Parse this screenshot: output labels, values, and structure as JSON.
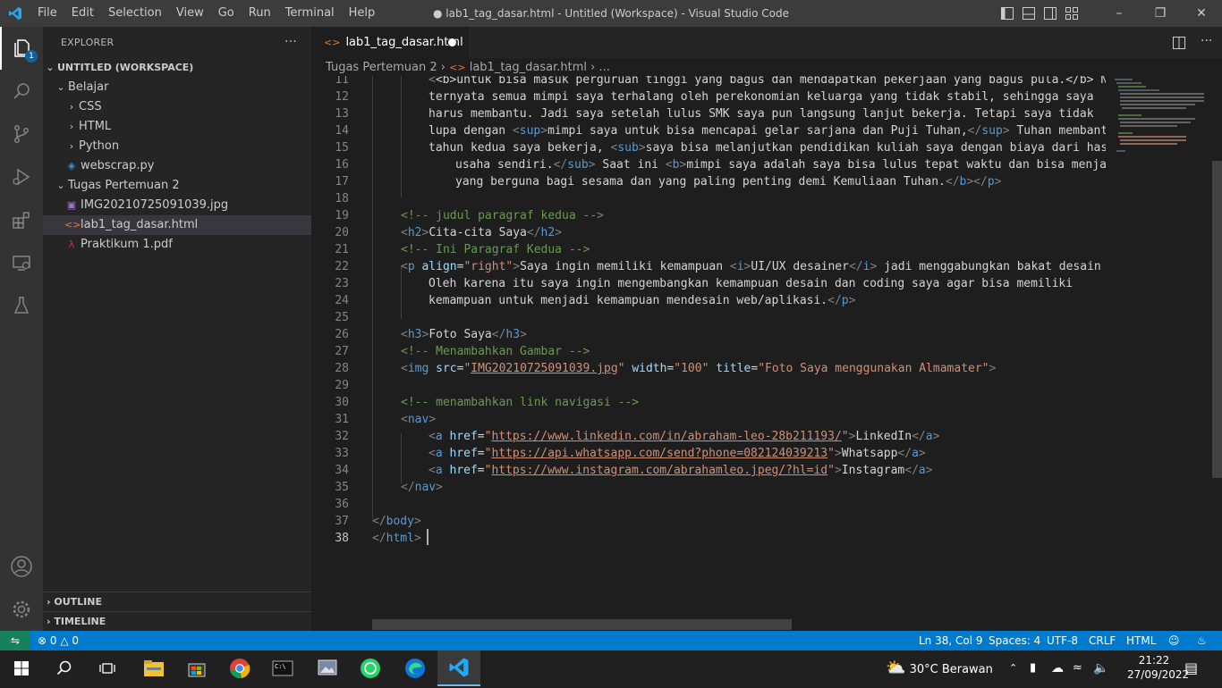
{
  "titlebar": {
    "menu": [
      "File",
      "Edit",
      "Selection",
      "View",
      "Go",
      "Run",
      "Terminal",
      "Help"
    ],
    "title": "● lab1_tag_dasar.html - Untitled (Workspace) - Visual Studio Code"
  },
  "activity": {
    "explorer_badge": "1"
  },
  "sidebar": {
    "header": "EXPLORER",
    "more": "···",
    "workspace": "UNTITLED (WORKSPACE)",
    "folder_belajar": "Belajar",
    "sub_css": "CSS",
    "sub_html": "HTML",
    "sub_python": "Python",
    "file_webscrap": "webscrap.py",
    "folder_tugas": "Tugas Pertemuan 2",
    "file_img": "IMG20210725091039.jpg",
    "file_html": "lab1_tag_dasar.html",
    "file_pdf": "Praktikum 1.pdf",
    "outline": "OUTLINE",
    "timeline": "TIMELINE"
  },
  "tab": {
    "label": "lab1_tag_dasar.html"
  },
  "breadcrumb": {
    "folder": "Tugas Pertemuan 2",
    "file": "lab1_tag_dasar.html",
    "more": "..."
  },
  "code": {
    "l11": "<b>untuk bisa masuk perguruan tinggi yang bagus dan mendapatkan pekerjaan yang bagus pula.</b> Nam",
    "l12": "ternyata semua mimpi saya terhalang oleh perekonomian keluarga yang tidak stabil, sehingga saya",
    "l13": "harus membantu. Jadi saya setelah lulus SMK saya pun langsung lanjut bekerja. Tetapi saya tidak",
    "l14a": "lupa dengan ",
    "l14b": "mimpi saya untuk bisa mencapai gelar sarjana dan Puji Tuhan,",
    "l14c": " Tuhan membantu",
    "l15a": "tahun kedua saya bekerja, ",
    "l15b": "saya bisa melanjutkan pendidikan kuliah saya dengan biaya dari hasil",
    "l16a": "usaha sendiri.",
    "l16b": " Saat ini ",
    "l16c": "mimpi saya adalah saya bisa lulus tepat waktu dan bisa menjadi",
    "l17a": "yang berguna bagi sesama dan yang paling penting demi Kemuliaan Tuhan.",
    "l19": "<!-- judul paragraf kedua -->",
    "l20": "Cita-cita Saya",
    "l21": "<!-- Ini Paragraf Kedua -->",
    "l22a": "Saya ingin memiliki kemampuan ",
    "l22b": "UI/UX desainer",
    "l22c": " jadi menggabungkan bakat desain da",
    "l23": "Oleh karena itu saya ingin mengembangkan kemampuan desain dan coding saya agar bisa memiliki",
    "l24": "kemampuan untuk menjadi kemampuan mendesain web/aplikasi.",
    "l26": "Foto Saya",
    "l27": "<!-- Menambahkan Gambar -->",
    "l28src": "IMG20210725091039.jpg",
    "l28width": "\"100\"",
    "l28title": "\"Foto Saya menggunakan Almamater\"",
    "l30": "<!-- menambahkan link navigasi -->",
    "l32href": "https://www.linkedin.com/in/abraham-leo-28b211193/",
    "l32text": "LinkedIn",
    "l33href": "https://api.whatsapp.com/send?phone=082124039213",
    "l33text": "Whatsapp",
    "l34href": "https://www.instagram.com/abrahamleo.jpeg/?hl=id",
    "l34text": "Instagram"
  },
  "line_numbers": [
    "11",
    "12",
    "13",
    "14",
    "15",
    "16",
    "17",
    "18",
    "19",
    "20",
    "21",
    "22",
    "23",
    "24",
    "25",
    "26",
    "27",
    "28",
    "29",
    "30",
    "31",
    "32",
    "33",
    "34",
    "35",
    "36",
    "37",
    "38"
  ],
  "status": {
    "errors": "0",
    "warnings": "0",
    "position": "Ln 38, Col 9",
    "spaces": "Spaces: 4",
    "encoding": "UTF-8",
    "eol": "CRLF",
    "language": "HTML"
  },
  "taskbar": {
    "weather": "30°C  Berawan",
    "time": "21:22",
    "date": "27/09/2022"
  }
}
